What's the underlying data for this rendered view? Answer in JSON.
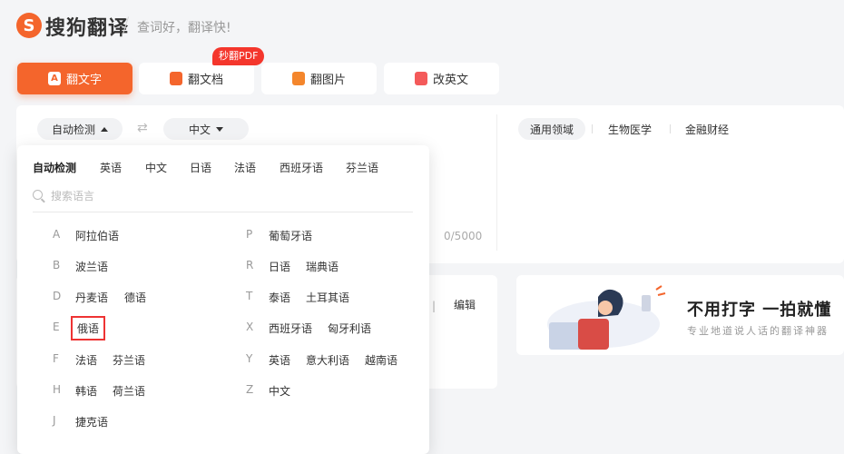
{
  "header": {
    "logo_letter": "S",
    "brand": "搜狗翻译",
    "slogan": "查词好，翻译快!"
  },
  "tabs": [
    {
      "icon_char": "A",
      "label": "翻文字"
    },
    {
      "icon_char": "",
      "label": "翻文档"
    },
    {
      "icon_char": "",
      "label": "翻图片"
    },
    {
      "icon_char": "",
      "label": "改英文"
    }
  ],
  "tab_badge": "秒翻PDF",
  "translator": {
    "source_lang": "自动检测",
    "swap_icon": "⇄",
    "target_lang": "中文",
    "counter": "0/5000",
    "domains": [
      "通用领域",
      "生物医学",
      "金融财经"
    ]
  },
  "result_toolbar": {
    "separator": "|",
    "edit_label": "编辑"
  },
  "promo": {
    "title": "不用打字 一拍就懂",
    "subtitle": "专业地道说人话的翻译神器"
  },
  "dropdown": {
    "quick_langs": [
      "自动检测",
      "英语",
      "中文",
      "日语",
      "法语",
      "西班牙语",
      "芬兰语"
    ],
    "search_placeholder": "搜索语言",
    "groups_left": [
      {
        "letter": "A",
        "langs": [
          "阿拉伯语"
        ]
      },
      {
        "letter": "B",
        "langs": [
          "波兰语"
        ]
      },
      {
        "letter": "D",
        "langs": [
          "丹麦语",
          "德语"
        ]
      },
      {
        "letter": "E",
        "langs": [
          "俄语"
        ]
      },
      {
        "letter": "F",
        "langs": [
          "法语",
          "芬兰语"
        ]
      },
      {
        "letter": "H",
        "langs": [
          "韩语",
          "荷兰语"
        ]
      },
      {
        "letter": "J",
        "langs": [
          "捷克语"
        ]
      }
    ],
    "groups_right": [
      {
        "letter": "P",
        "langs": [
          "葡萄牙语"
        ]
      },
      {
        "letter": "R",
        "langs": [
          "日语",
          "瑞典语"
        ]
      },
      {
        "letter": "T",
        "langs": [
          "泰语",
          "土耳其语"
        ]
      },
      {
        "letter": "X",
        "langs": [
          "西班牙语",
          "匈牙利语"
        ]
      },
      {
        "letter": "Y",
        "langs": [
          "英语",
          "意大利语",
          "越南语"
        ]
      },
      {
        "letter": "Z",
        "langs": [
          "中文"
        ]
      }
    ],
    "selected": "俄语"
  },
  "colors": {
    "accent": "#f4652c",
    "badge": "#f4362c",
    "highlight": "#e33333"
  }
}
